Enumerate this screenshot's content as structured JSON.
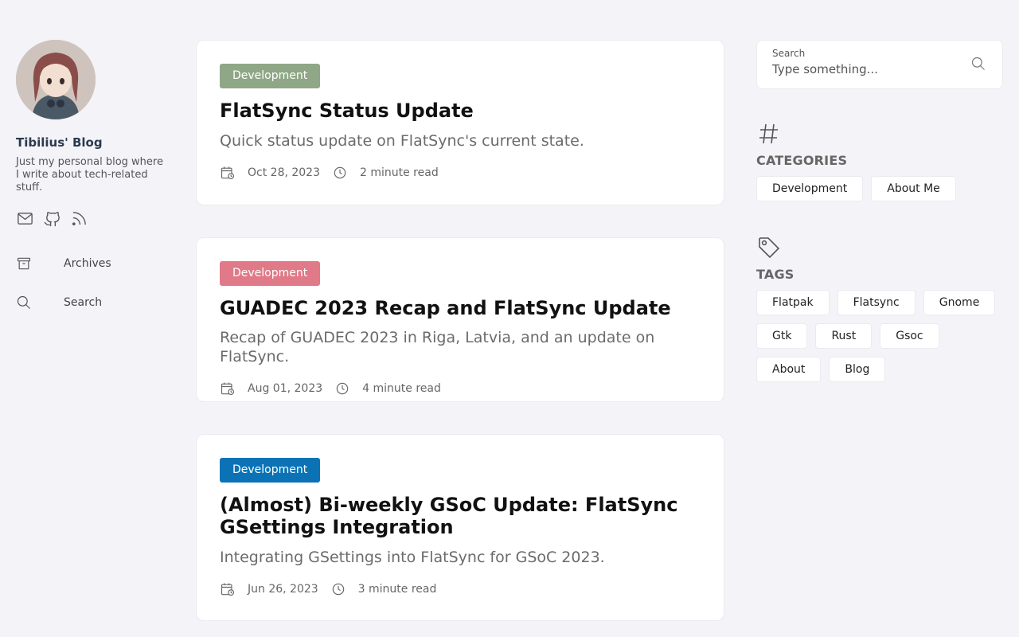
{
  "site": {
    "title": "Tibilius' Blog",
    "description": "Just my personal blog where I write about tech-related stuff."
  },
  "social_icons": [
    "mail-icon",
    "github-icon",
    "rss-icon"
  ],
  "nav": [
    {
      "label": "Archives",
      "icon": "archive-icon"
    },
    {
      "label": "Search",
      "icon": "search-icon"
    }
  ],
  "posts": [
    {
      "category": "Development",
      "category_color": "#8fa786",
      "title": "FlatSync Status Update",
      "summary": "Quick status update on FlatSync's current state.",
      "date": "Oct 28, 2023",
      "read_time": "2 minute read"
    },
    {
      "category": "Development",
      "category_color": "#e07a88",
      "title": "GUADEC 2023 Recap and FlatSync Update",
      "summary": "Recap of GUADEC 2023 in Riga, Latvia, and an update on FlatSync.",
      "date": "Aug 01, 2023",
      "read_time": "4 minute read"
    },
    {
      "category": "Development",
      "category_color": "#0b73b5",
      "title": "(Almost) Bi-weekly GSoC Update: FlatSync GSettings Integration",
      "summary": "Integrating GSettings into FlatSync for GSoC 2023.",
      "date": "Jun 26, 2023",
      "read_time": "3 minute read"
    }
  ],
  "search": {
    "label": "Search",
    "placeholder": "Type something..."
  },
  "categories": {
    "title": "CATEGORIES",
    "items": [
      "Development",
      "About Me"
    ]
  },
  "tags": {
    "title": "TAGS",
    "items": [
      "Flatpak",
      "Flatsync",
      "Gnome",
      "Gtk",
      "Rust",
      "Gsoc",
      "About",
      "Blog"
    ]
  }
}
